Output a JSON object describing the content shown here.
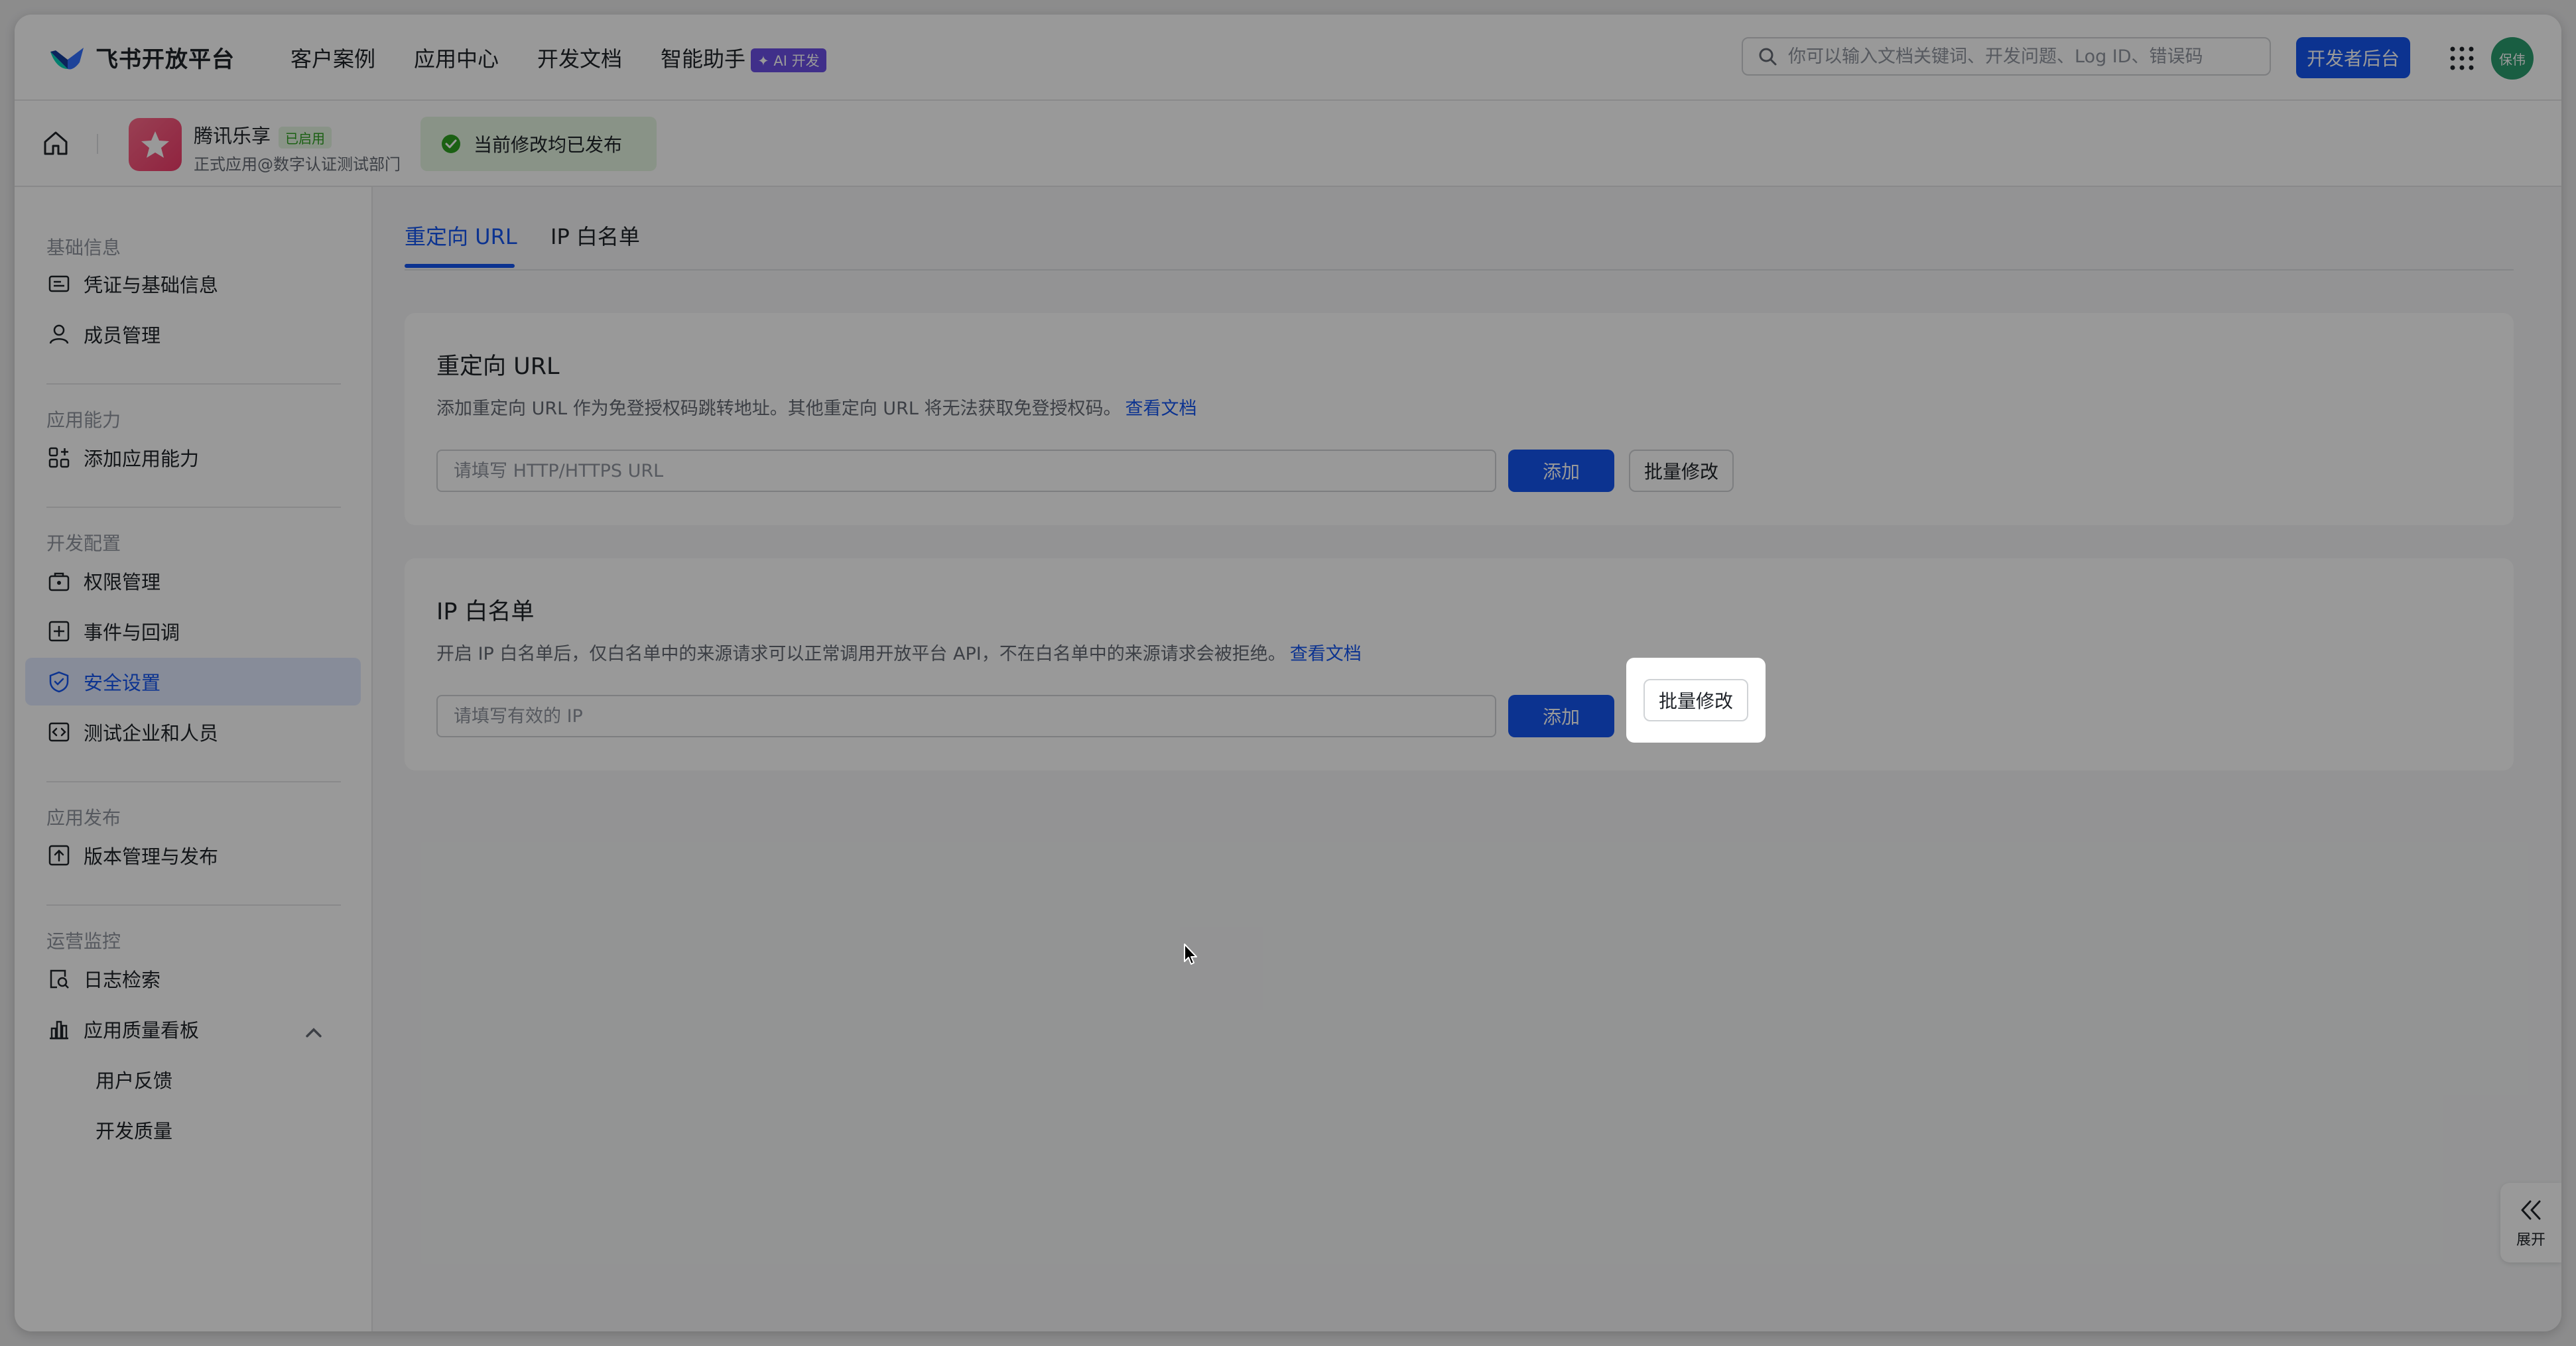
{
  "brand": {
    "name": "飞书开放平台"
  },
  "topnav": {
    "items": [
      "客户案例",
      "应用中心",
      "开发文档",
      "智能助手"
    ],
    "ai_badge": "✦ AI 开发"
  },
  "search": {
    "placeholder": "你可以输入文档关键词、开发问题、Log ID、错误码"
  },
  "header": {
    "dev_console": "开发者后台",
    "avatar_text": "保伟"
  },
  "app": {
    "name": "腾讯乐享",
    "status": "已启用",
    "subtitle": "正式应用@数字认证测试部门",
    "publish_status": "当前修改均已发布"
  },
  "sidebar": {
    "groups": [
      "基础信息",
      "应用能力",
      "开发配置",
      "应用发布",
      "运营监控"
    ],
    "items": [
      {
        "label": "凭证与基础信息",
        "icon": "credential-icon"
      },
      {
        "label": "成员管理",
        "icon": "user-icon"
      },
      {
        "label": "添加应用能力",
        "icon": "grid-plus-icon"
      },
      {
        "label": "权限管理",
        "icon": "permission-icon"
      },
      {
        "label": "事件与回调",
        "icon": "event-icon"
      },
      {
        "label": "安全设置",
        "icon": "shield-icon"
      },
      {
        "label": "测试企业和人员",
        "icon": "code-icon"
      },
      {
        "label": "版本管理与发布",
        "icon": "upload-icon"
      },
      {
        "label": "日志检索",
        "icon": "log-search-icon"
      },
      {
        "label": "应用质量看板",
        "icon": "bar-chart-icon"
      },
      {
        "label": "用户反馈"
      },
      {
        "label": "开发质量"
      }
    ]
  },
  "tabs": [
    "重定向 URL",
    "IP 白名单"
  ],
  "redirect_card": {
    "title": "重定向 URL",
    "desc": "添加重定向 URL 作为免登授权码跳转地址。其他重定向 URL 将无法获取免登授权码。",
    "link": "查看文档",
    "placeholder": "请填写 HTTP/HTTPS URL",
    "add": "添加",
    "batch": "批量修改"
  },
  "ip_card": {
    "title": "IP 白名单",
    "desc": "开启 IP 白名单后，仅白名单中的来源请求可以正常调用开放平台 API，不在白名单中的来源请求会被拒绝。",
    "link": "查看文档",
    "placeholder": "请填写有效的 IP",
    "add": "添加",
    "batch": "批量修改"
  },
  "expand": {
    "label": "展开"
  },
  "colors": {
    "accent": "#1456f0",
    "success": "#2ea121",
    "overlay": "rgba(0,0,0,0.40)"
  }
}
